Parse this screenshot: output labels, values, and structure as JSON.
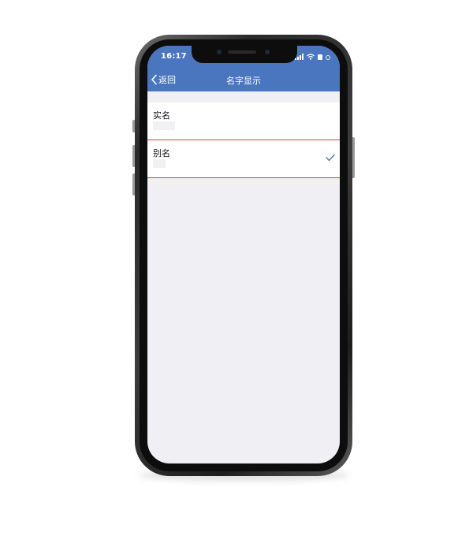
{
  "status_bar": {
    "time": "16:17",
    "icons": [
      "signal-icon",
      "wifi-icon",
      "battery-icon",
      "screen-rotation-lock-icon"
    ]
  },
  "nav_bar": {
    "back_label": "返回",
    "title": "名字显示"
  },
  "name_options": [
    {
      "label": "实名",
      "selected": false
    },
    {
      "label": "别名",
      "selected": true
    }
  ],
  "colors": {
    "nav_background": "#4a76c0",
    "screen_background": "#efeff4",
    "row_divider": "#e03a3a",
    "checkmark": "#4a76c0"
  }
}
